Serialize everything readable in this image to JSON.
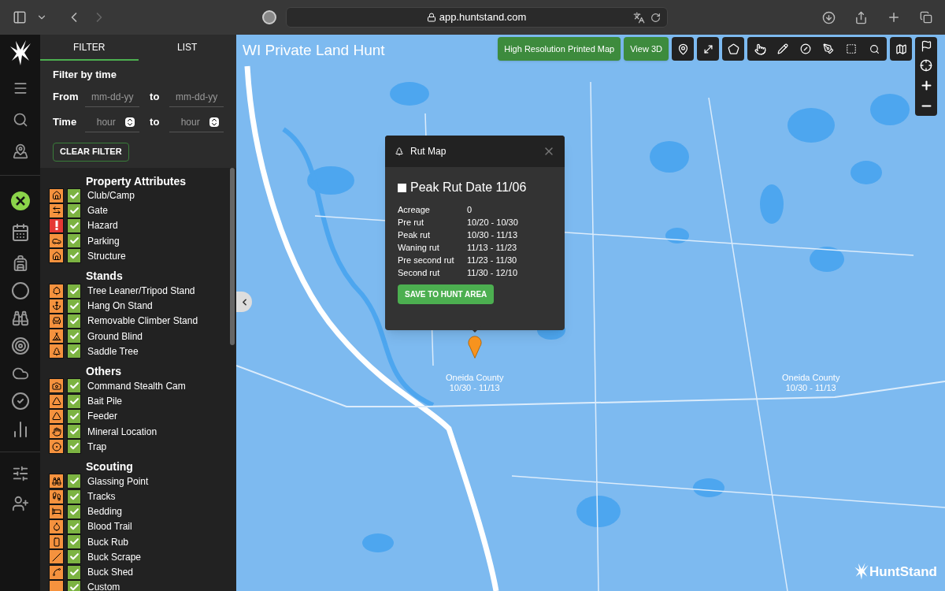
{
  "browser": {
    "url": "app.huntstand.com"
  },
  "panel": {
    "tabs": [
      {
        "label": "FILTER",
        "selected": true
      },
      {
        "label": "LIST",
        "selected": false
      }
    ],
    "filter": {
      "title": "Filter by time",
      "rows": [
        {
          "kind": "date",
          "label": "From",
          "start_placeholder": "mm-dd-yy",
          "joiner": "to",
          "end_placeholder": "mm-dd-yy"
        },
        {
          "kind": "time",
          "label": "Time",
          "start_placeholder": "hour",
          "joiner": "to",
          "end_placeholder": "hour"
        }
      ],
      "clear_button": "CLEAR FILTER"
    },
    "sections": [
      {
        "title": "Property Attributes",
        "items": [
          {
            "label": "Club/Camp",
            "checked": true,
            "color": "#f5923e"
          },
          {
            "label": "Gate",
            "checked": true,
            "color": "#f5923e"
          },
          {
            "label": "Hazard",
            "checked": true,
            "color": "#e53935"
          },
          {
            "label": "Parking",
            "checked": true,
            "color": "#f5923e"
          },
          {
            "label": "Structure",
            "checked": true,
            "color": "#f5923e"
          }
        ]
      },
      {
        "title": "Stands",
        "items": [
          {
            "label": "Tree Leaner/Tripod Stand",
            "checked": true,
            "color": "#f5923e"
          },
          {
            "label": "Hang On Stand",
            "checked": true,
            "color": "#f5923e"
          },
          {
            "label": "Removable Climber Stand",
            "checked": true,
            "color": "#f5923e"
          },
          {
            "label": "Ground Blind",
            "checked": true,
            "color": "#f5923e"
          },
          {
            "label": "Saddle Tree",
            "checked": true,
            "color": "#f5923e"
          }
        ]
      },
      {
        "title": "Others",
        "items": [
          {
            "label": "Command Stealth Cam",
            "checked": true,
            "color": "#f5923e"
          },
          {
            "label": "Bait Pile",
            "checked": true,
            "color": "#f5923e"
          },
          {
            "label": "Feeder",
            "checked": true,
            "color": "#f5923e"
          },
          {
            "label": "Mineral Location",
            "checked": true,
            "color": "#f5923e"
          },
          {
            "label": "Trap",
            "checked": true,
            "color": "#f5923e"
          }
        ]
      },
      {
        "title": "Scouting",
        "items": [
          {
            "label": "Glassing Point",
            "checked": true,
            "color": "#f5923e"
          },
          {
            "label": "Tracks",
            "checked": true,
            "color": "#f5923e"
          },
          {
            "label": "Bedding",
            "checked": true,
            "color": "#f5923e"
          },
          {
            "label": "Blood Trail",
            "checked": true,
            "color": "#f5923e"
          },
          {
            "label": "Buck Rub",
            "checked": true,
            "color": "#f5923e"
          },
          {
            "label": "Buck Scrape",
            "checked": true,
            "color": "#f5923e"
          },
          {
            "label": "Buck Shed",
            "checked": true,
            "color": "#f5923e"
          },
          {
            "label": "Custom",
            "checked": true,
            "color": "#f5923e"
          }
        ]
      }
    ]
  },
  "map": {
    "title": "WI Private Land Hunt",
    "actions": [
      "High Resolution Printed Map",
      "View 3D"
    ],
    "region_labels": [
      {
        "name": "Oneida County",
        "dates": "10/30 - 11/13"
      },
      {
        "name": "Oneida County",
        "dates": "10/30 - 11/13"
      }
    ],
    "popup": {
      "title": "Rut Map",
      "heading": "Peak Rut Date 11/06",
      "rows": [
        {
          "label": "Acreage",
          "value": "0"
        },
        {
          "label": "Pre rut",
          "value": "10/20 - 10/30"
        },
        {
          "label": "Peak rut",
          "value": "10/30 - 11/13"
        },
        {
          "label": "Waning rut",
          "value": "11/13 - 11/23"
        },
        {
          "label": "Pre second rut",
          "value": "11/23 - 11/30"
        },
        {
          "label": "Second rut",
          "value": "11/30 - 12/10"
        }
      ],
      "button": "SAVE TO HUNT AREA"
    },
    "logo": "HuntStand"
  }
}
